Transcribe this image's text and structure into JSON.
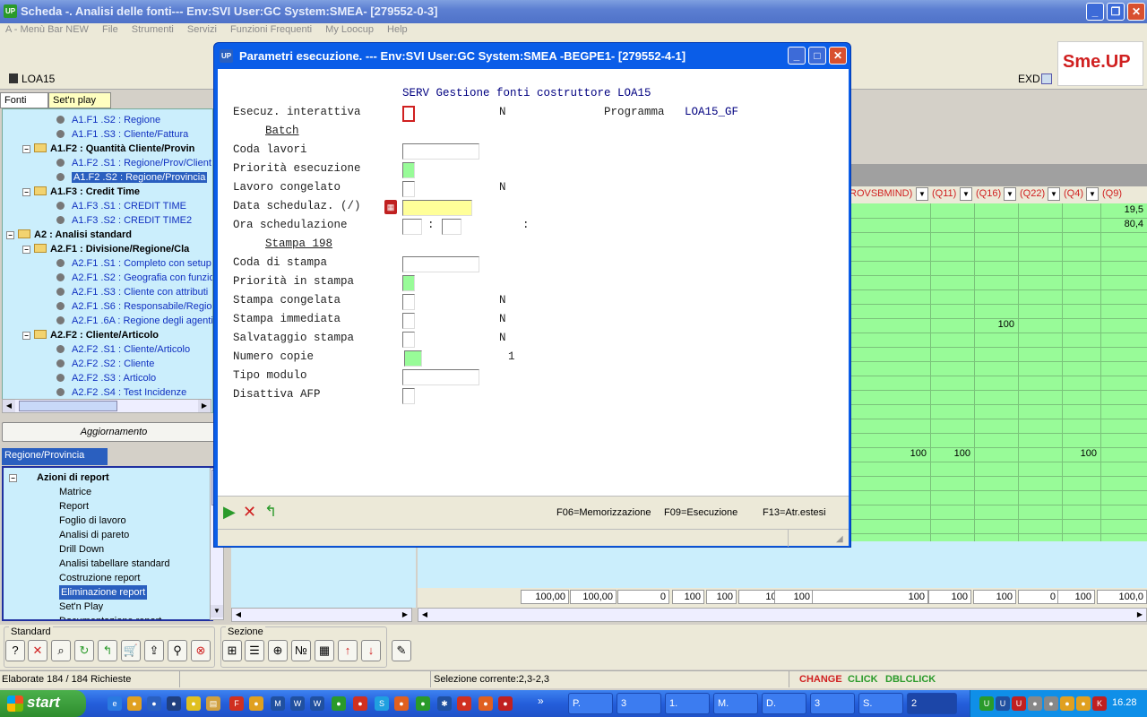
{
  "window": {
    "title": "Scheda -. Analisi delle fonti--- Env:SVI User:GC System:SMEA- [279552-0-3]",
    "app_badge": "UP"
  },
  "menu": [
    "A - Menù Bar NEW",
    "File",
    "Strumenti",
    "Servizi",
    "Funzioni Frequenti",
    "My Loocup",
    "Help"
  ],
  "header": {
    "code": "LOA15",
    "exd": "EXD",
    "logo": "Sme.UP"
  },
  "left_tabs": [
    "Fonti",
    "Set'n play"
  ],
  "tree": [
    {
      "label": "A1.F1 .S2 : Regione",
      "kind": "leaf"
    },
    {
      "label": "A1.F1 .S3 : Cliente/Fattura",
      "kind": "leaf"
    },
    {
      "label": "A1.F2 : Quantità Cliente/Provin",
      "kind": "folder2"
    },
    {
      "label": "A1.F2 .S1 : Regione/Prov/Client",
      "kind": "leaf"
    },
    {
      "label": "A1.F2 .S2 : Regione/Provincia",
      "kind": "leafsel"
    },
    {
      "label": "A1.F3 : Credit Time",
      "kind": "folder2"
    },
    {
      "label": "A1.F3 .S1 : CREDIT TIME",
      "kind": "leaf"
    },
    {
      "label": "A1.F3 .S2 : CREDIT TIME2",
      "kind": "leaf"
    },
    {
      "label": "A2 : Analisi standard",
      "kind": "folder1"
    },
    {
      "label": "A2.F1 : Divisione/Regione/Cla",
      "kind": "folder2"
    },
    {
      "label": "A2.F1 .S1 : Completo con setup",
      "kind": "leaf"
    },
    {
      "label": "A2.F1 .S2 : Geografia con funzio",
      "kind": "leaf"
    },
    {
      "label": "A2.F1 .S3 : Cliente con attributi",
      "kind": "leaf"
    },
    {
      "label": "A2.F1 .S6 : Responsabile/Regio",
      "kind": "leaf"
    },
    {
      "label": "A2.F1 .6A : Regione degli agenti",
      "kind": "leaf"
    },
    {
      "label": "A2.F2 : Cliente/Articolo",
      "kind": "folder2"
    },
    {
      "label": "A2.F2 .S1 : Cliente/Articolo",
      "kind": "leaf"
    },
    {
      "label": "A2.F2 .S2 : Cliente",
      "kind": "leaf"
    },
    {
      "label": "A2.F2 .S3 : Articolo",
      "kind": "leaf"
    },
    {
      "label": "A2.F2 .S4 : Test Incidenze",
      "kind": "leaf"
    }
  ],
  "aggiornamento": "Aggiornamento",
  "panel2_tab": "Regione/Provincia",
  "actions_title": "Azioni di report",
  "actions": [
    "Matrice",
    "Report",
    "Foglio di lavoro",
    "Analisi di pareto",
    "Drill Down",
    "Analisi tabellare standard",
    "Costruzione report",
    "Eliminazione report",
    "Set'n Play",
    "Documentazione report"
  ],
  "actions_selected": 7,
  "grid": {
    "columns": [
      "ROVSBMIND)",
      "(Q11)",
      "(Q16)",
      "(Q22)",
      "(Q4)",
      "(Q9)"
    ],
    "cells": [
      {
        "row": 0,
        "col": 5,
        "v": "19,5"
      },
      {
        "row": 1,
        "col": 5,
        "v": "80,4"
      },
      {
        "row": 8,
        "col": 2,
        "v": "100"
      },
      {
        "row": 17,
        "col": 0,
        "v": "100"
      },
      {
        "row": 17,
        "col": 1,
        "v": "100"
      },
      {
        "row": 17,
        "col": 4,
        "v": "100"
      }
    ],
    "totals": [
      "100,00",
      "100,00",
      "0",
      "100",
      "100",
      "100,00",
      "100",
      "100",
      "100",
      "100",
      "0",
      "100",
      "100,0"
    ]
  },
  "bottom": {
    "group1": "Standard",
    "group2": "Sezione"
  },
  "status": {
    "left": "Elaborate 184 / 184 Richieste",
    "selection": "Selezione corrente:2,3-2,3",
    "change": "CHANGE",
    "click": "CLICK",
    "dblclick": "DBLCLICK"
  },
  "taskbar": {
    "start": "start",
    "tasks": [
      "P.",
      "3",
      "1.",
      "M.",
      "D.",
      "3",
      "S.",
      "2"
    ],
    "clock": "16.28"
  },
  "dialog": {
    "title": "Parametri esecuzione. --- Env:SVI User:GC System:SMEA -BEGPE1- [279552-4-1]",
    "heading": "SERV Gestione fonti costruttore LOA15",
    "esecuz_label": "Esecuz. interattiva",
    "esecuz_value": "N",
    "programma_label": "Programma",
    "programma_value": "LOA15_GF",
    "batch_label": "Batch",
    "coda_lavori": "Coda lavori",
    "priorita_esec": "Priorità esecuzione",
    "lavoro_congelato": "Lavoro congelato",
    "lavoro_congelato_value": "N",
    "data_sched": "Data schedulaz. (/)",
    "ora_sched": "Ora  schedulazione",
    "colon": ":",
    "stampa_label": "Stampa 198",
    "coda_stampa": "Coda di stampa",
    "priorita_stampa": "Priorità in stampa",
    "stampa_congelata": "Stampa congelata",
    "stampa_congelata_value": "N",
    "stampa_immediata": "Stampa immediata",
    "stampa_immediata_value": "N",
    "salvataggio": "Salvataggio stampa",
    "salvataggio_value": "N",
    "numero_copie": "Numero copie",
    "numero_copie_value": "1",
    "tipo_modulo": "Tipo modulo",
    "disattiva": "Disattiva AFP",
    "f06": "F06=Memorizzazione",
    "f09": "F09=Esecuzione",
    "f13": "F13=Atr.estesi"
  },
  "colors": {
    "accent": "#0a5de8",
    "grid": "#98fb98",
    "tree_bg": "#cbeefc",
    "required": "#d02020",
    "yellow_field": "#ffff99",
    "green_field": "#98fb98"
  }
}
